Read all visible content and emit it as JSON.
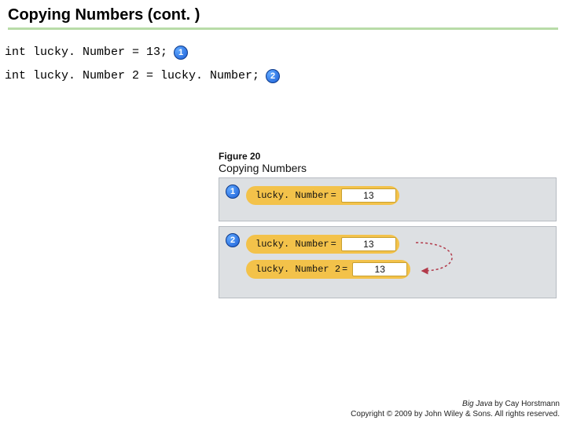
{
  "title": "Copying Numbers (cont. )",
  "code": {
    "line1": "int lucky. Number = 13;",
    "line2": "int lucky. Number 2 = lucky. Number;"
  },
  "badges": {
    "one": "1",
    "two": "2"
  },
  "figure": {
    "label": "Figure 20",
    "caption": "Copying Numbers",
    "panel1": {
      "var": "lucky. Number",
      "eq": "=",
      "val": "13"
    },
    "panel2": {
      "row1": {
        "var": "lucky. Number",
        "eq": "=",
        "val": "13"
      },
      "row2": {
        "var": "lucky. Number 2",
        "eq": "=",
        "val": "13"
      }
    }
  },
  "footer": {
    "line1_a": "Big Java",
    "line1_b": " by Cay Horstmann",
    "line2": "Copyright © 2009 by John Wiley & Sons. All rights reserved."
  }
}
